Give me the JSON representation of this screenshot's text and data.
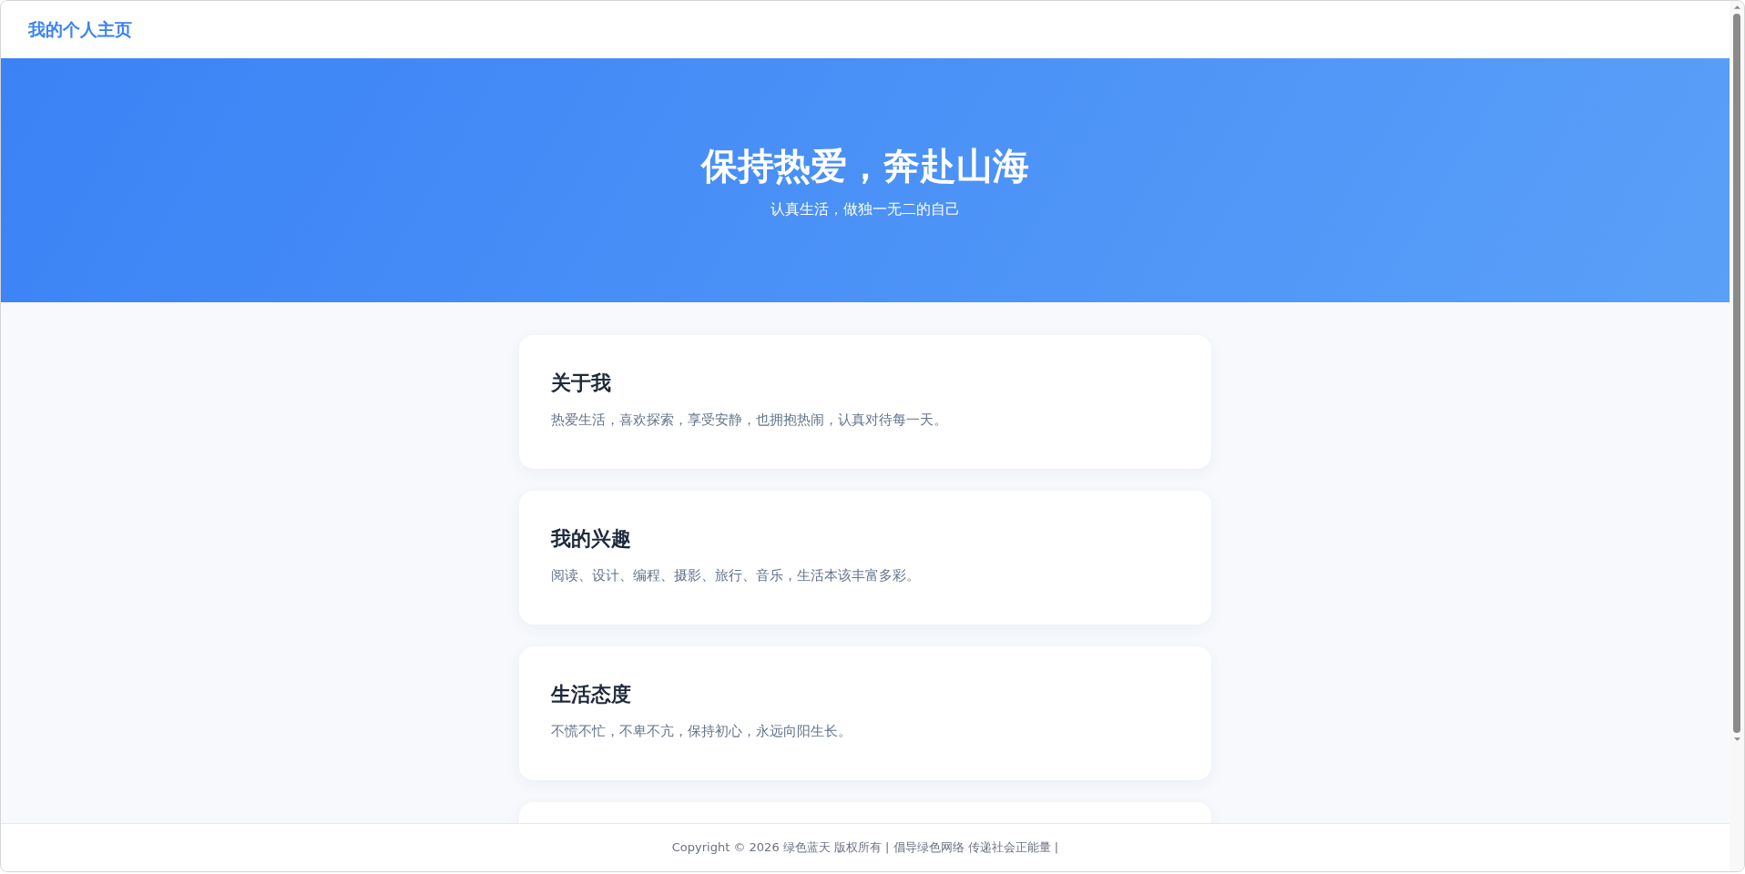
{
  "header": {
    "site_title": "我的个人主页"
  },
  "hero": {
    "title": "保持热爱，奔赴山海",
    "subtitle": "认真生活，做独一无二的自己"
  },
  "cards": [
    {
      "title": "关于我",
      "text": "热爱生活，喜欢探索，享受安静，也拥抱热闹，认真对待每一天。"
    },
    {
      "title": "我的兴趣",
      "text": "阅读、设计、编程、摄影、旅行、音乐，生活本该丰富多彩。"
    },
    {
      "title": "生活态度",
      "text": "不慌不忙，不卑不亢，保持初心，永远向阳生长。"
    }
  ],
  "footer": {
    "text": "Copyright © 2026 绿色蓝天 版权所有 | 倡导绿色网络 传递社会正能量 |"
  }
}
